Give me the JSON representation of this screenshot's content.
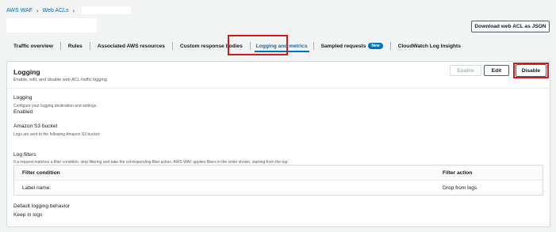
{
  "breadcrumb": {
    "root": "AWS WAF",
    "web_acls": "Web ACLs"
  },
  "header": {
    "download_label": "Download web ACL as JSON"
  },
  "tabs": [
    {
      "label": "Traffic overview"
    },
    {
      "label": "Rules"
    },
    {
      "label": "Associated AWS resources"
    },
    {
      "label": "Custom response bodies"
    },
    {
      "label": "Logging and metrics",
      "active": true
    },
    {
      "label": "Sampled requests",
      "badge": "New"
    },
    {
      "label": "CloudWatch Log Insights"
    }
  ],
  "logging_panel": {
    "title": "Logging",
    "description": "Enable, edit, and disable web ACL traffic logging.",
    "enable_label": "Enable",
    "edit_label": "Edit",
    "disable_label": "Disable",
    "logging": {
      "title": "Logging",
      "description": "Configure your logging destination and settings.",
      "value": "Enabled"
    },
    "s3": {
      "title": "Amazon S3 bucket",
      "description": "Logs are sent to the following Amazon S3 bucket:"
    },
    "log_filters": {
      "title": "Log filters",
      "description": "If a request matches a filter condition, stop filtering and take the corresponding filter action. AWS WAF applies filters in the order shown, starting from the top.",
      "columns": [
        "Filter condition",
        "Filter action"
      ],
      "rows": [
        {
          "condition": "Label name:",
          "action": "Drop from logs"
        }
      ]
    },
    "default_behavior": {
      "title": "Default logging behavior",
      "value": "Keep in logs"
    }
  },
  "colors": {
    "accent": "#0073bb",
    "highlight": "#d91515"
  }
}
